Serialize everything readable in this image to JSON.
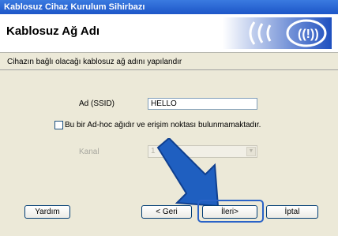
{
  "window": {
    "title": "Kablosuz Cihaz Kurulum Sihirbazı"
  },
  "header": {
    "title": "Kablosuz Ağ Adı"
  },
  "instruction": "Cihazın bağlı olacağı kablosuz ağ adını yapılandır",
  "ssid": {
    "label": "Ad (SSID)",
    "value": "HELLO"
  },
  "adhoc": {
    "label": "Bu bir Ad-hoc ağıdır ve erişim noktası bulunmamaktadır.",
    "checked": false
  },
  "channel": {
    "label": "Kanal",
    "value": "1"
  },
  "buttons": {
    "help": "Yardım",
    "back": "< Geri",
    "next": "İleri>",
    "cancel": "İptal"
  },
  "colors": {
    "accent": "#2a63c7",
    "titlebar": "#1d56c8"
  },
  "icons": {
    "pointer": "blue-arrow-icon",
    "logo": "wireless-logo-icon"
  }
}
